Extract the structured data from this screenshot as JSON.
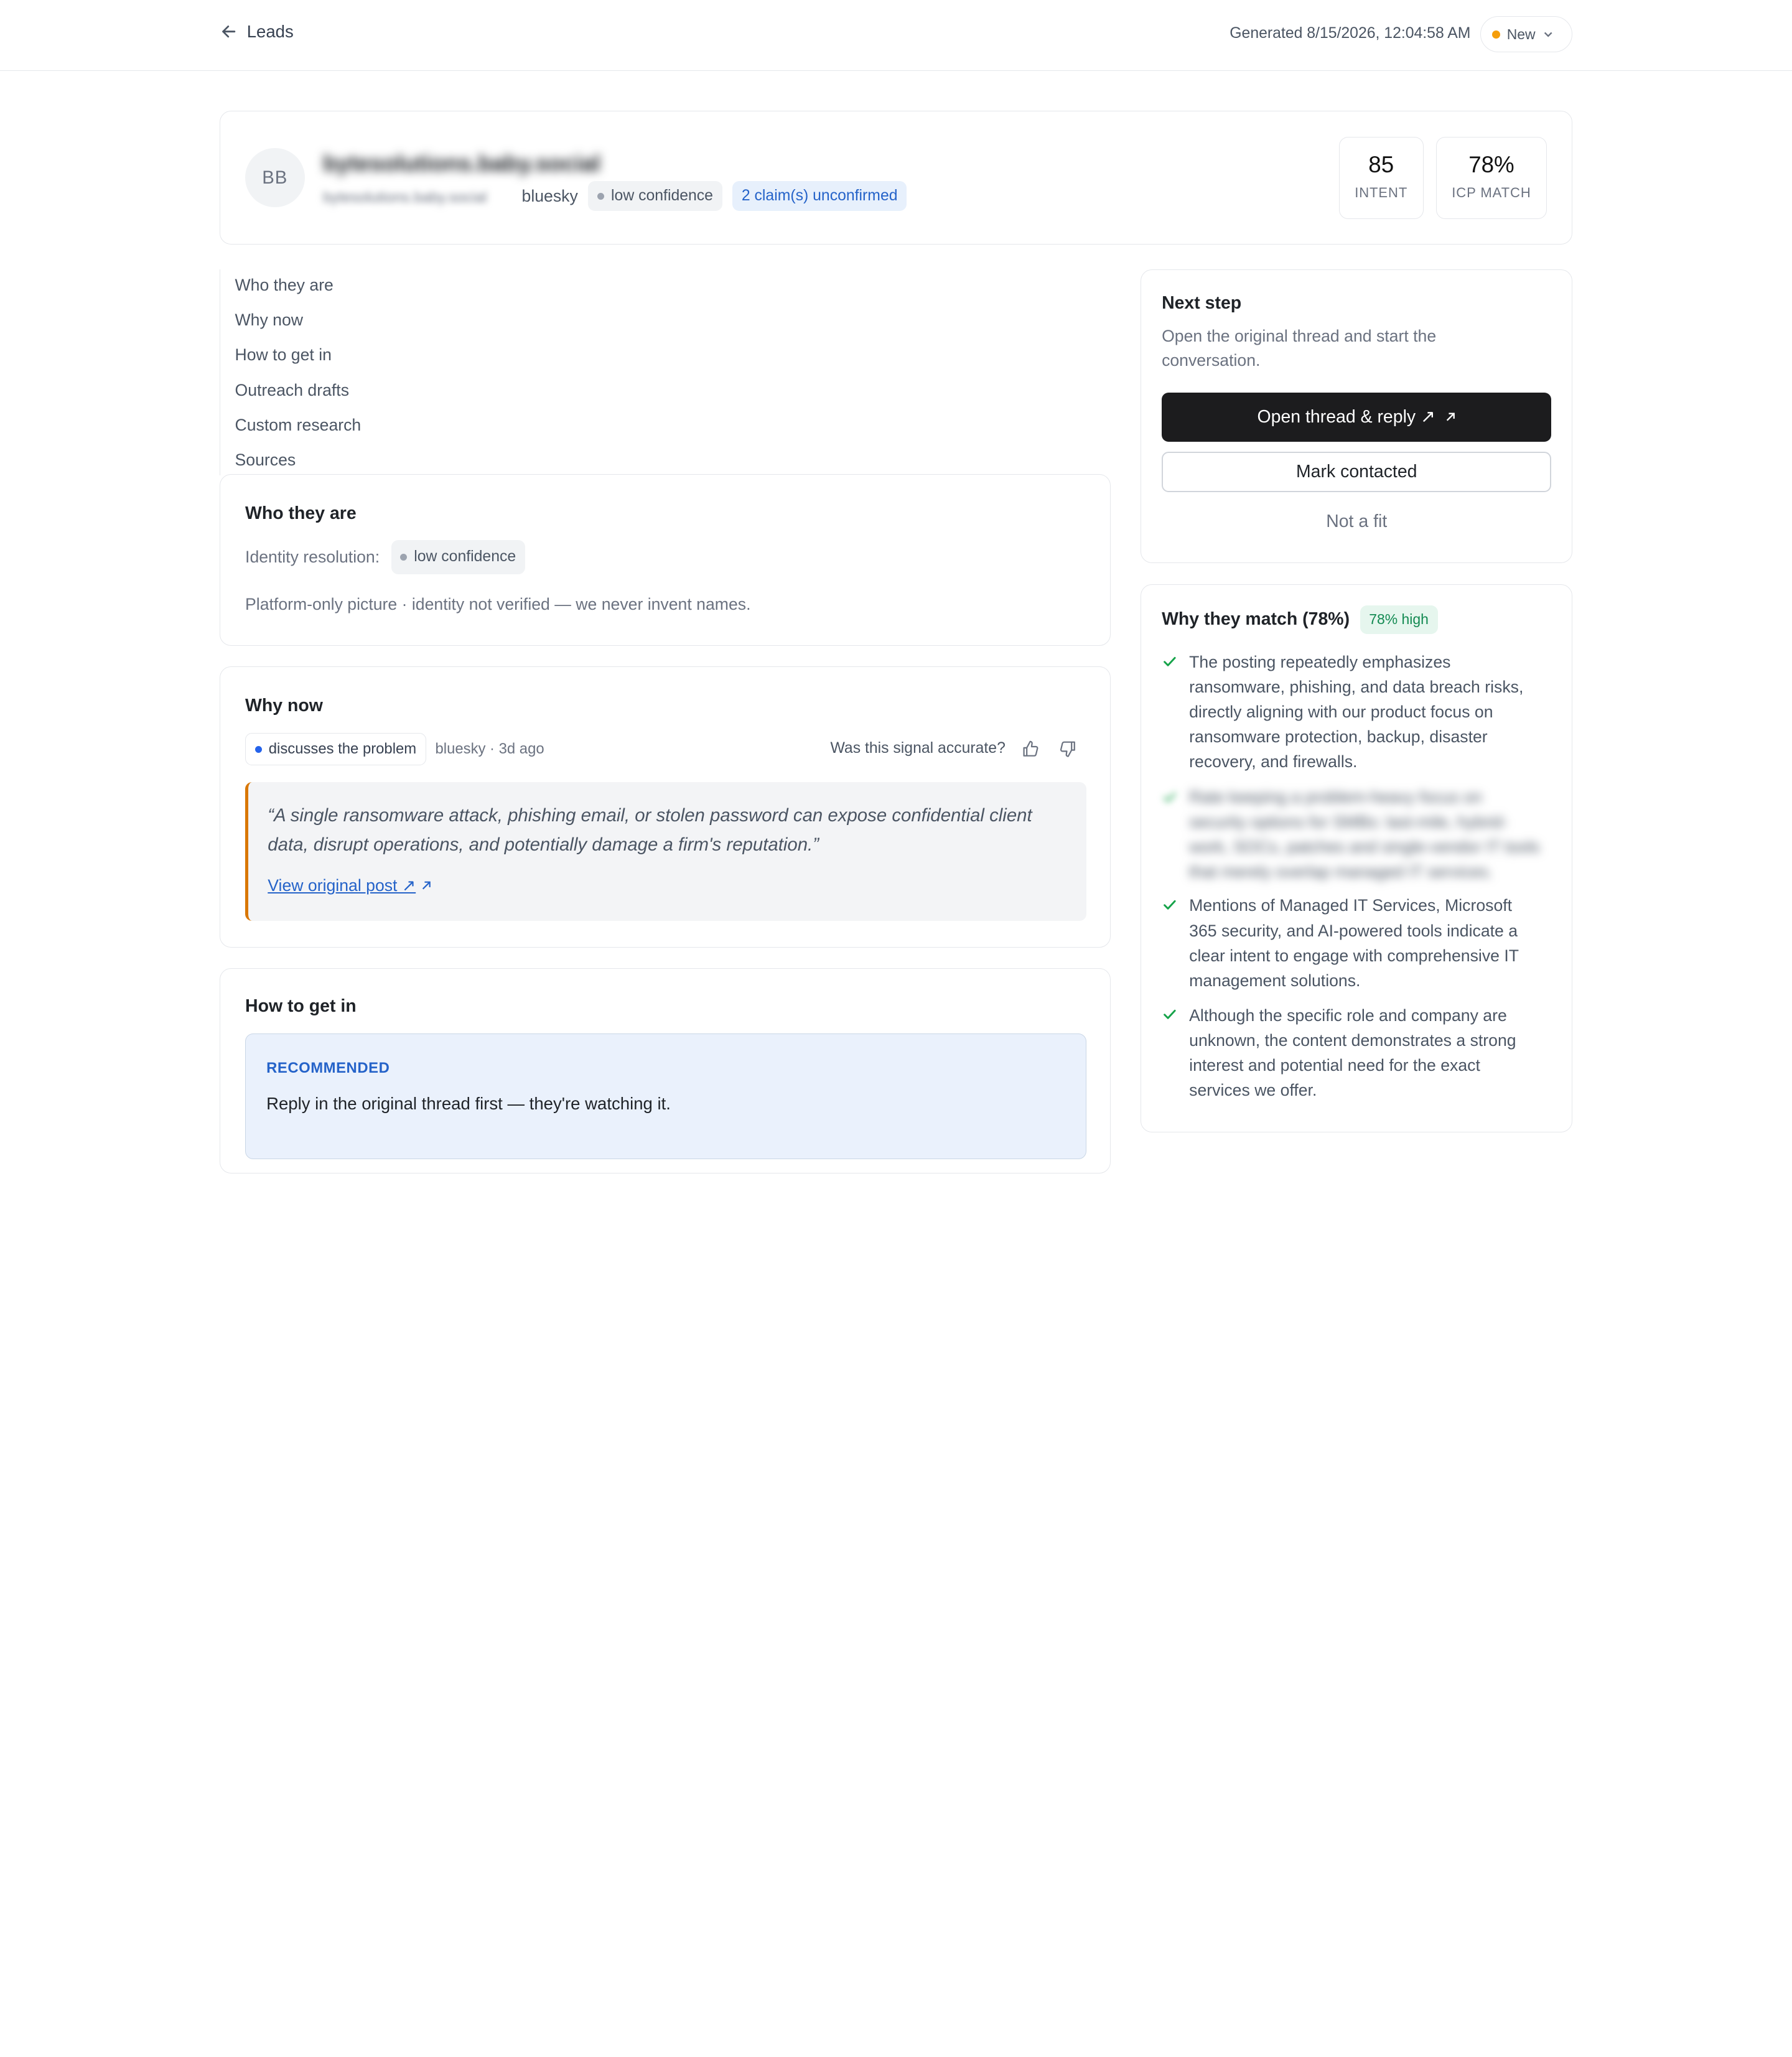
{
  "topbar": {
    "back_label": "Leads",
    "generated": "Generated 8/15/2026, 12:04:58 AM",
    "status": "New",
    "status_color": "#f59e0b"
  },
  "lead": {
    "initials": "BB",
    "name": "bytesolutions.baby.social",
    "handle": "bytesolutions.baby.social",
    "platform": "bluesky",
    "confidence": "low confidence",
    "claims": "2 claim(s) unconfirmed",
    "intent_value": "85",
    "intent_label": "INTENT",
    "icp_value": "78%",
    "icp_label": "ICP MATCH"
  },
  "toc": [
    "Who they are",
    "Why now",
    "How to get in",
    "Outreach drafts",
    "Custom research",
    "Sources"
  ],
  "who": {
    "title": "Who they are",
    "identity_label": "Identity resolution:",
    "identity_value": "low confidence",
    "note": "Platform-only picture · identity not verified — we never invent names."
  },
  "why_now": {
    "title": "Why now",
    "signal": "discusses the problem",
    "signal_color": "#2563eb",
    "meta": "bluesky · 3d ago",
    "accuracy_question": "Was this signal accurate?",
    "quote": "“A single ransomware attack, phishing email, or stolen password can expose confidential client data, disrupt operations, and potentially damage a firm's reputation.”",
    "link": "View original post ↗"
  },
  "how": {
    "title": "How to get in",
    "badge": "RECOMMENDED",
    "text": "Reply in the original thread first — they're watching it."
  },
  "next_step": {
    "title": "Next step",
    "desc": "Open the original thread and start the conversation.",
    "primary": "Open thread & reply ↗",
    "secondary": "Mark contacted",
    "tertiary": "Not a fit"
  },
  "match": {
    "title": "Why they match (78%)",
    "badge": "78% high",
    "reasons": [
      "The posting repeatedly emphasizes ransomware, phishing, and data breach risks, directly aligning with our product focus on ransomware protection, backup, disaster recovery, and firewalls.",
      "Rate keeping a problem-heavy focus on security options for SMBs: last-mile, hybrid-work, SOCs, patches and single-vendor IT tools that merely overlap managed IT services.",
      "Mentions of Managed IT Services, Microsoft 365 security, and AI-powered tools indicate a clear intent to engage with comprehensive IT management solutions.",
      "Although the specific role and company are unknown, the content demonstrates a strong interest and potential need for the exact services we offer."
    ]
  }
}
